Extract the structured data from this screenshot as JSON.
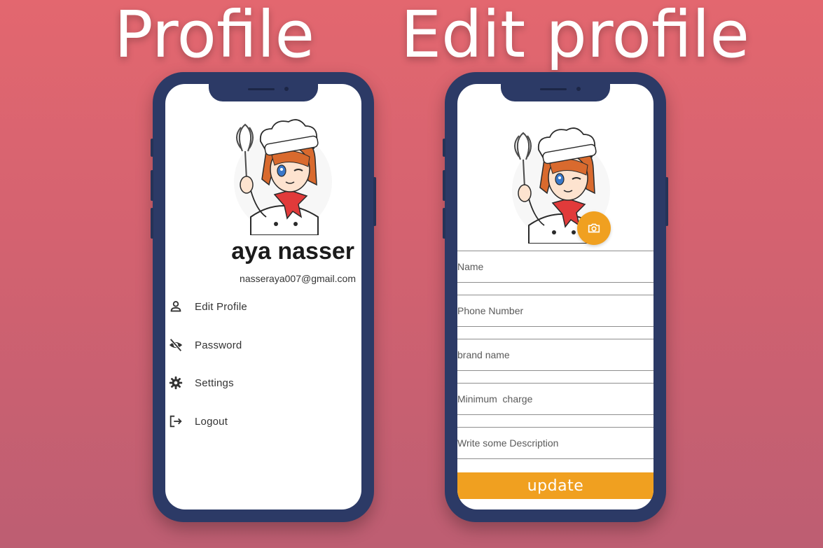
{
  "titles": {
    "left": "Profile",
    "right": "Edit profile"
  },
  "profile": {
    "name": "aya nasser",
    "email": "nasseraya007@gmail.com",
    "menu": [
      {
        "label": "Edit Profile",
        "icon": "person-icon"
      },
      {
        "label": "Password",
        "icon": "eye-off-icon"
      },
      {
        "label": "Settings",
        "icon": "gear-icon"
      },
      {
        "label": "Logout",
        "icon": "logout-icon"
      }
    ]
  },
  "edit": {
    "fields": [
      {
        "placeholder": "Name"
      },
      {
        "placeholder": "Phone Number"
      },
      {
        "placeholder": "brand name"
      },
      {
        "placeholder": "Minimum  charge"
      },
      {
        "placeholder": "Write some Description"
      }
    ],
    "update_label": "update",
    "camera_icon": "camera-icon"
  },
  "colors": {
    "accent": "#f0a020",
    "phone_frame": "#2c3a66",
    "background_top": "#e3676f",
    "background_bottom": "#bd5e72"
  }
}
